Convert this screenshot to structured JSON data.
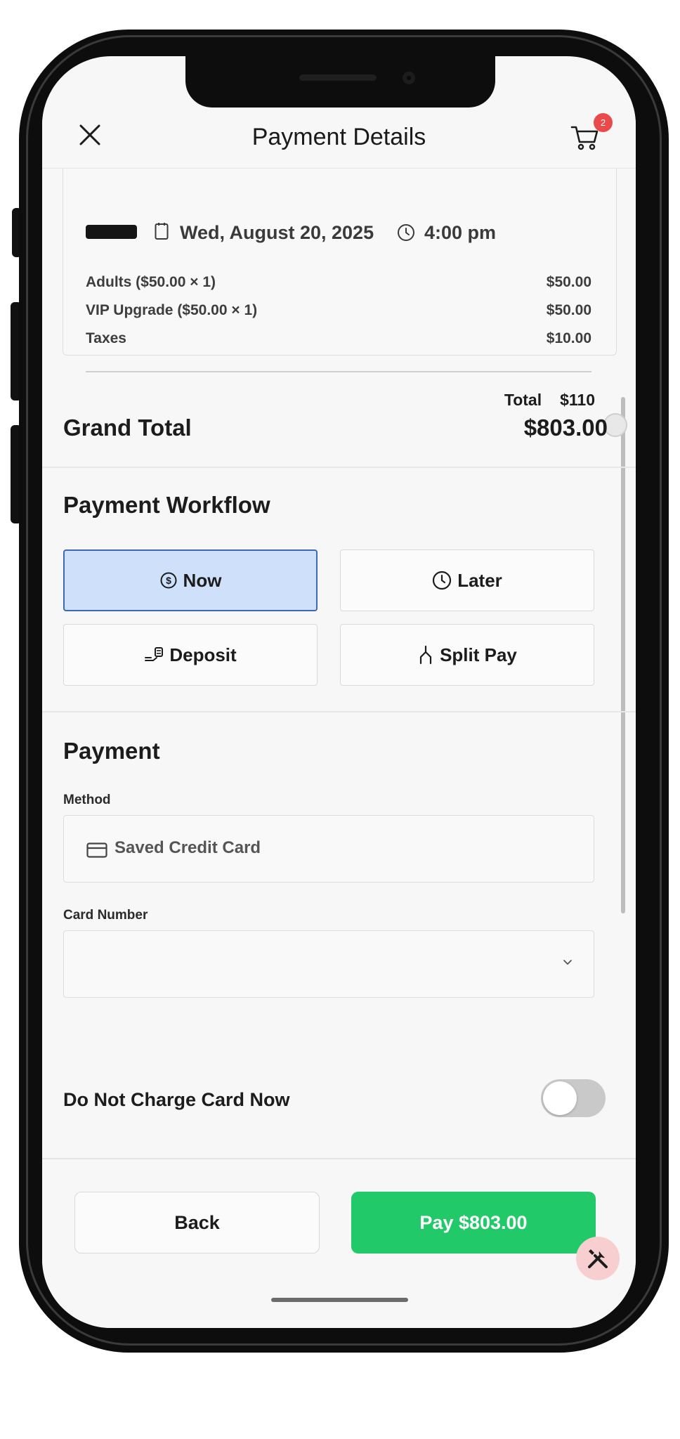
{
  "header": {
    "title": "Payment Details",
    "cart_count": "2"
  },
  "booking": {
    "date": "Wed, August 20, 2025",
    "time": "4:00 pm",
    "line_items": [
      {
        "label": "Adults ($50.00 × 1)",
        "amount": "$50.00"
      },
      {
        "label": "VIP Upgrade ($50.00 × 1)",
        "amount": "$50.00"
      },
      {
        "label": "Taxes",
        "amount": "$10.00"
      }
    ],
    "total_label": "Total",
    "total_value": "$110"
  },
  "grand_total": {
    "label": "Grand Total",
    "value": "$803.00"
  },
  "workflow": {
    "title": "Payment Workflow",
    "options": [
      {
        "label": "Now",
        "icon": "dollar-circle-icon",
        "selected": true
      },
      {
        "label": "Later",
        "icon": "clock-icon",
        "selected": false
      },
      {
        "label": "Deposit",
        "icon": "deposit-icon",
        "selected": false
      },
      {
        "label": "Split Pay",
        "icon": "split-pay-icon",
        "selected": false
      }
    ]
  },
  "payment": {
    "title": "Payment",
    "method_label": "Method",
    "method_value": "Saved Credit Card",
    "method_icon": "credit-card-icon",
    "card_number_label": "Card Number",
    "card_number_value": "",
    "no_charge_label": "Do Not Charge Card Now",
    "no_charge_enabled": false
  },
  "footer": {
    "back_label": "Back",
    "pay_label": "Pay $803.00"
  },
  "colors": {
    "accent_green": "#22c968",
    "selected_bg": "#cfe0fb",
    "selected_border": "#3e69b8",
    "badge_red": "#e94a4a"
  }
}
